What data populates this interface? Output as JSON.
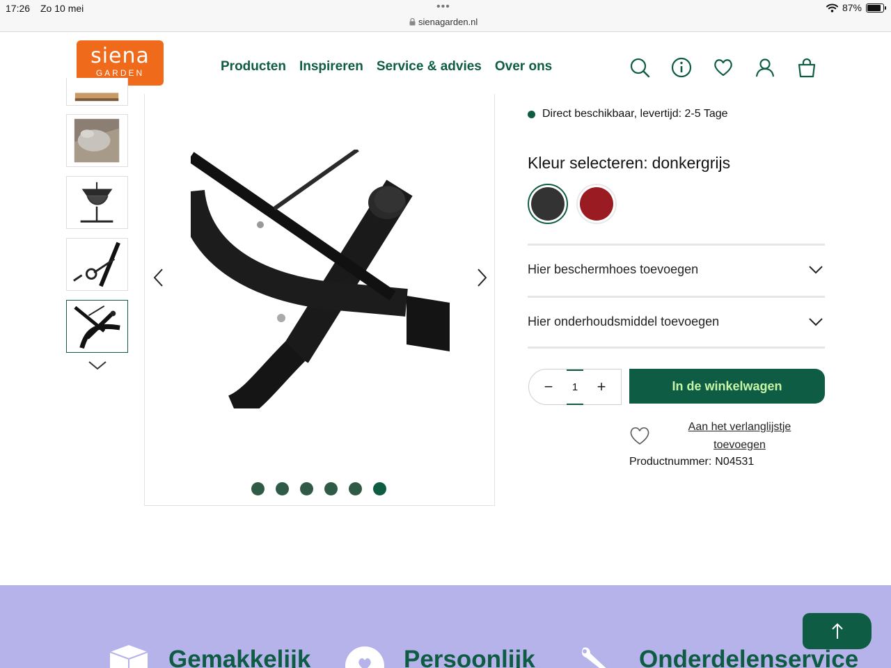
{
  "status_bar": {
    "time": "17:26",
    "date": "Zo 10 mei",
    "url": "sienagarden.nl",
    "battery": "87%"
  },
  "header": {
    "logo_top": "siena",
    "logo_bottom": "GARDEN",
    "nav": [
      "Producten",
      "Inspireren",
      "Service & advies",
      "Over ons"
    ],
    "icons": [
      "search-icon",
      "info-icon",
      "heart-icon",
      "user-icon",
      "bag-icon"
    ]
  },
  "gallery": {
    "slide_count": 6,
    "active_slide": 6
  },
  "product": {
    "availability": "Direct beschikbaar, levertijd: 2-5 Tage",
    "color_label": "Kleur selecteren:",
    "color_value": "donkergrijs",
    "swatches": [
      {
        "name": "donkergrijs",
        "color": "#333333",
        "selected": true
      },
      {
        "name": "rood",
        "color": "#9a1c22",
        "selected": false
      }
    ],
    "accordions": [
      "Hier beschermhoes toevoegen",
      "Hier onderhoudsmiddel toevoegen"
    ],
    "quantity": "1",
    "qty_minus": "−",
    "qty_plus": "+",
    "cart_button": "In de winkelwagen",
    "wishlist_link": "Aan het verlanglijstje toevoegen",
    "product_number_label": "Productnummer:",
    "product_number": "N04531"
  },
  "footer_band": {
    "items": [
      "Gemakkelijk",
      "Persoonlijk",
      "Onderdelenservice"
    ]
  },
  "colors": {
    "brand_green": "#0d5c43",
    "brand_orange": "#ef6a1a",
    "band_lavender": "#b6b2ea",
    "cart_text": "#c8f5a8"
  }
}
